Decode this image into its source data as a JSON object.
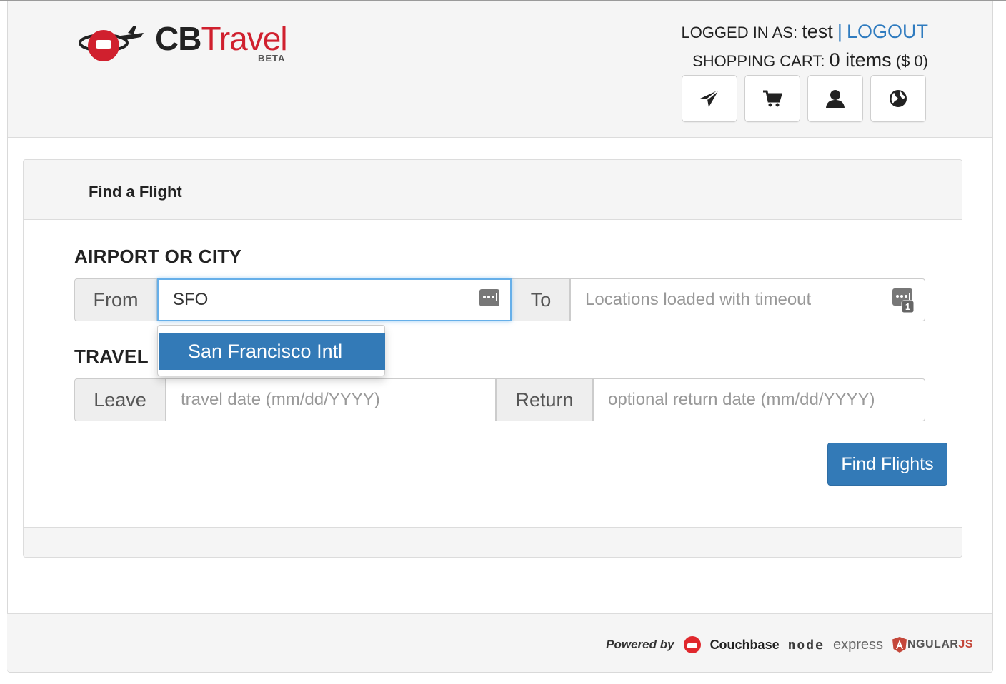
{
  "brand": {
    "name_bold": "CB",
    "name_accent": "Travel",
    "badge": "BETA",
    "accent_color": "#d0202e"
  },
  "user": {
    "logged_in_label": "LOGGED IN AS:",
    "username": "test",
    "separator": "|",
    "logout_label": "LOGOUT"
  },
  "cart": {
    "label": "SHOPPING CART:",
    "items_text": "0 items",
    "total_text": "($ 0)"
  },
  "nav": {
    "buttons": [
      {
        "icon": "send-icon"
      },
      {
        "icon": "cart-icon"
      },
      {
        "icon": "user-icon"
      },
      {
        "icon": "globe-icon"
      }
    ]
  },
  "panel": {
    "title": "Find a Flight"
  },
  "airport_section": {
    "label": "AIRPORT OR CITY",
    "from_label": "From",
    "from_value": "SFO",
    "to_label": "To",
    "to_placeholder": "Locations loaded with timeout",
    "to_badge": "1"
  },
  "autocomplete": {
    "items": [
      "San Francisco Intl"
    ]
  },
  "travel_section": {
    "label": "TRAVEL",
    "leave_label": "Leave",
    "leave_placeholder": "travel date (mm/dd/YYYY)",
    "return_label": "Return",
    "return_placeholder": "optional return date (mm/dd/YYYY)"
  },
  "actions": {
    "find_flights_label": "Find Flights",
    "primary_color": "#337ab7"
  },
  "footer": {
    "powered_by": "Powered by",
    "couchbase": "Couchbase",
    "node": "node",
    "express": "express",
    "angular_main": "NGULAR",
    "angular_js": "JS"
  }
}
